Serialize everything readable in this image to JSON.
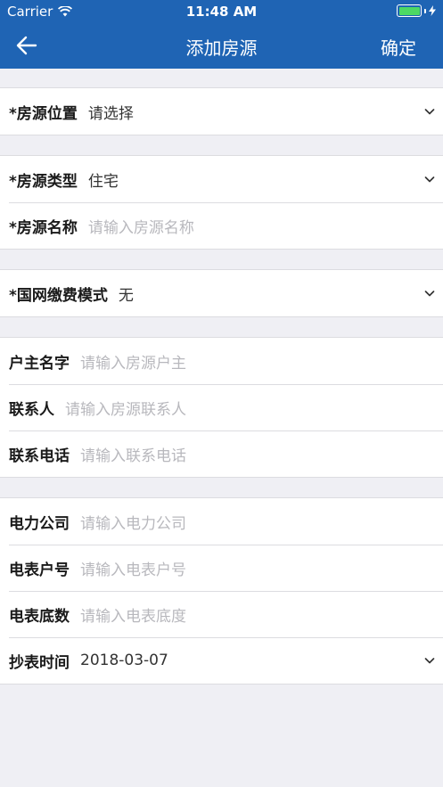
{
  "status_bar": {
    "carrier": "Carrier",
    "time": "11:48 AM"
  },
  "navbar": {
    "title": "添加房源",
    "confirm": "确定"
  },
  "groups": [
    [
      {
        "label": "*房源位置",
        "value": "请选择",
        "dropdown": true
      }
    ],
    [
      {
        "label": "*房源类型",
        "value": "住宅",
        "dropdown": true
      },
      {
        "label": "*房源名称",
        "placeholder": "请输入房源名称"
      }
    ],
    [
      {
        "label": "*国网缴费模式",
        "value": "无",
        "dropdown": true
      }
    ],
    [
      {
        "label": "户主名字",
        "placeholder": "请输入房源户主"
      },
      {
        "label": "联系人",
        "placeholder": "请输入房源联系人"
      },
      {
        "label": "联系电话",
        "placeholder": "请输入联系电话"
      }
    ],
    [
      {
        "label": "电力公司",
        "placeholder": "请输入电力公司"
      },
      {
        "label": "电表户号",
        "placeholder": "请输入电表户号"
      },
      {
        "label": "电表底数",
        "placeholder": "请输入电表底度"
      },
      {
        "label": "抄表时间",
        "value": "2018-03-07",
        "dropdown": true
      }
    ]
  ]
}
